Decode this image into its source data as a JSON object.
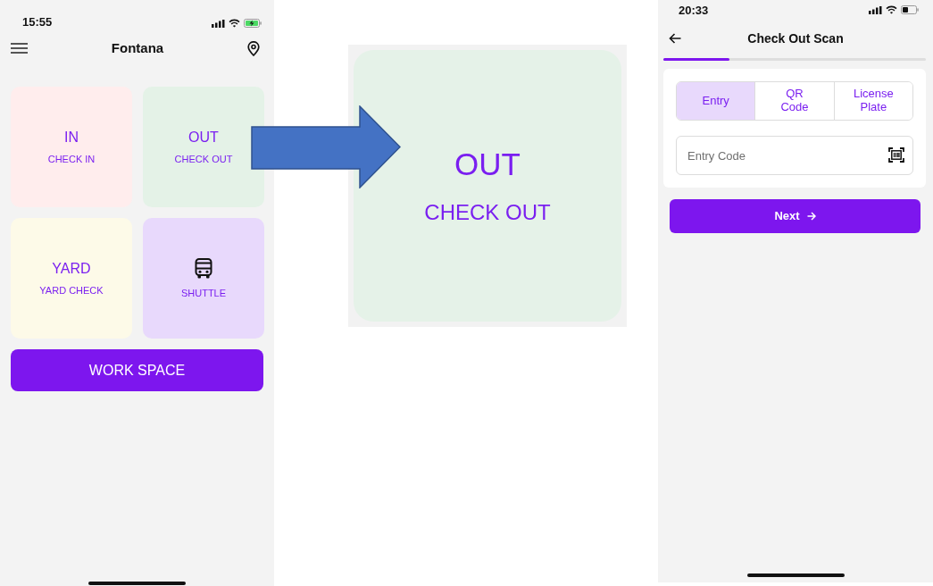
{
  "left_phone": {
    "status_bar": {
      "time": "15:55"
    },
    "header": {
      "title": "Fontana"
    },
    "tiles": [
      {
        "kind": "text",
        "title": "IN",
        "label": "CHECK IN",
        "color": "#ffeded"
      },
      {
        "kind": "text",
        "title": "OUT",
        "label": "CHECK OUT",
        "color": "#e4f2e7"
      },
      {
        "kind": "text",
        "title": "YARD",
        "label": "YARD CHECK",
        "color": "#fdfae8"
      },
      {
        "kind": "icon",
        "label": "SHUTTLE",
        "color": "#e8d9fc"
      }
    ],
    "workspace_button": {
      "label": "WORK SPACE"
    }
  },
  "zoomed_tile": {
    "title": "OUT",
    "label": "CHECK OUT"
  },
  "right_phone": {
    "status_bar": {
      "time": "20:33"
    },
    "header": {
      "title": "Check Out Scan"
    },
    "progress": {
      "level": 0.25
    },
    "tabs": [
      {
        "label": "Entry",
        "selected": true
      },
      {
        "label": "QR Code",
        "selected": false
      },
      {
        "label": "License Plate",
        "selected": false
      }
    ],
    "entry_field": {
      "placeholder": "Entry Code"
    },
    "next_button": {
      "label": "Next"
    }
  }
}
